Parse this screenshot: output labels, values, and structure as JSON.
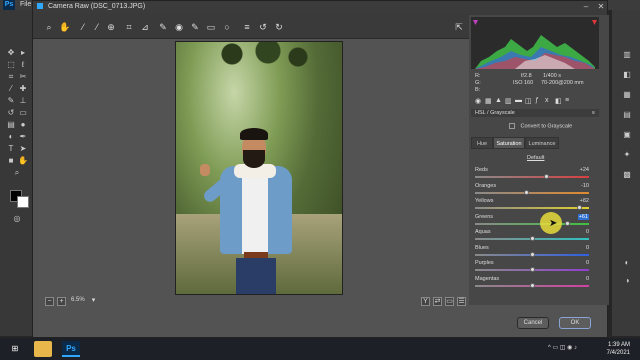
{
  "photoshop": {
    "logo": "Ps",
    "menu_first": "File",
    "left_tools": [
      "move-icon",
      "marquee-icon",
      "lasso-icon",
      "crop-icon",
      "eyedropper-icon",
      "healing-icon",
      "brush-icon",
      "stamp-icon",
      "history-brush-icon",
      "eraser-icon",
      "gradient-icon",
      "blur-icon",
      "dodge-icon",
      "pen-icon",
      "type-icon",
      "path-select-icon",
      "shape-icon",
      "hand-icon",
      "zoom-icon"
    ]
  },
  "camera_raw": {
    "title": "Camera Raw (DSC_0713.JPG)",
    "toolbar_icons": [
      "zoom-icon",
      "hand-icon",
      "white-balance-icon",
      "color-sampler-icon",
      "target-adjust-icon",
      "crop-icon",
      "straighten-icon",
      "spot-removal-icon",
      "red-eye-icon",
      "adjustment-brush-icon",
      "graduated-filter-icon",
      "radial-filter-icon",
      "preferences-icon",
      "rotate-left-icon",
      "rotate-right-icon"
    ],
    "preview_zoom": "6.5%",
    "camera_info": {
      "r_label": "R:",
      "g_label": "G:",
      "b_label": "B:",
      "aperture": "f/2.8",
      "shutter": "1/400 s",
      "iso": "ISO 160",
      "lens": "70-200@200 mm"
    },
    "panel_title": "HSL / Grayscale",
    "convert_label": "Convert to Grayscale",
    "tabs": [
      "Hue",
      "Saturation",
      "Luminance"
    ],
    "active_tab": "Saturation",
    "default_label": "Default",
    "sliders": [
      {
        "label": "Reds",
        "value": "+24",
        "level": 24,
        "gradient": "linear-gradient(90deg,#8a8a8a,#d84040)"
      },
      {
        "label": "Oranges",
        "value": "-10",
        "level": -10,
        "gradient": "linear-gradient(90deg,#8a8a8a,#e08a30)"
      },
      {
        "label": "Yellows",
        "value": "+82",
        "level": 82,
        "gradient": "linear-gradient(90deg,#8a8a8a,#e0d030)"
      },
      {
        "label": "Greens",
        "value": "+61",
        "level": 61,
        "gradient": "linear-gradient(90deg,#8a8a8a,#40c040)"
      },
      {
        "label": "Aquas",
        "value": "0",
        "level": 0,
        "gradient": "linear-gradient(90deg,#8a8a8a,#30c0c0)"
      },
      {
        "label": "Blues",
        "value": "0",
        "level": 0,
        "gradient": "linear-gradient(90deg,#8a8a8a,#3060e0)"
      },
      {
        "label": "Purples",
        "value": "0",
        "level": 0,
        "gradient": "linear-gradient(90deg,#8a8a8a,#9040d0)"
      },
      {
        "label": "Magentas",
        "value": "0",
        "level": 0,
        "gradient": "linear-gradient(90deg,#8a8a8a,#d040a0)"
      }
    ],
    "cancel_label": "Cancel",
    "ok_label": "OK"
  },
  "taskbar": {
    "time": "1:39 AM",
    "date": "7/4/2021"
  },
  "colors": {
    "accent": "#31a8ff",
    "dialog_bg": "#535353",
    "selection": "#2f6fd0"
  }
}
